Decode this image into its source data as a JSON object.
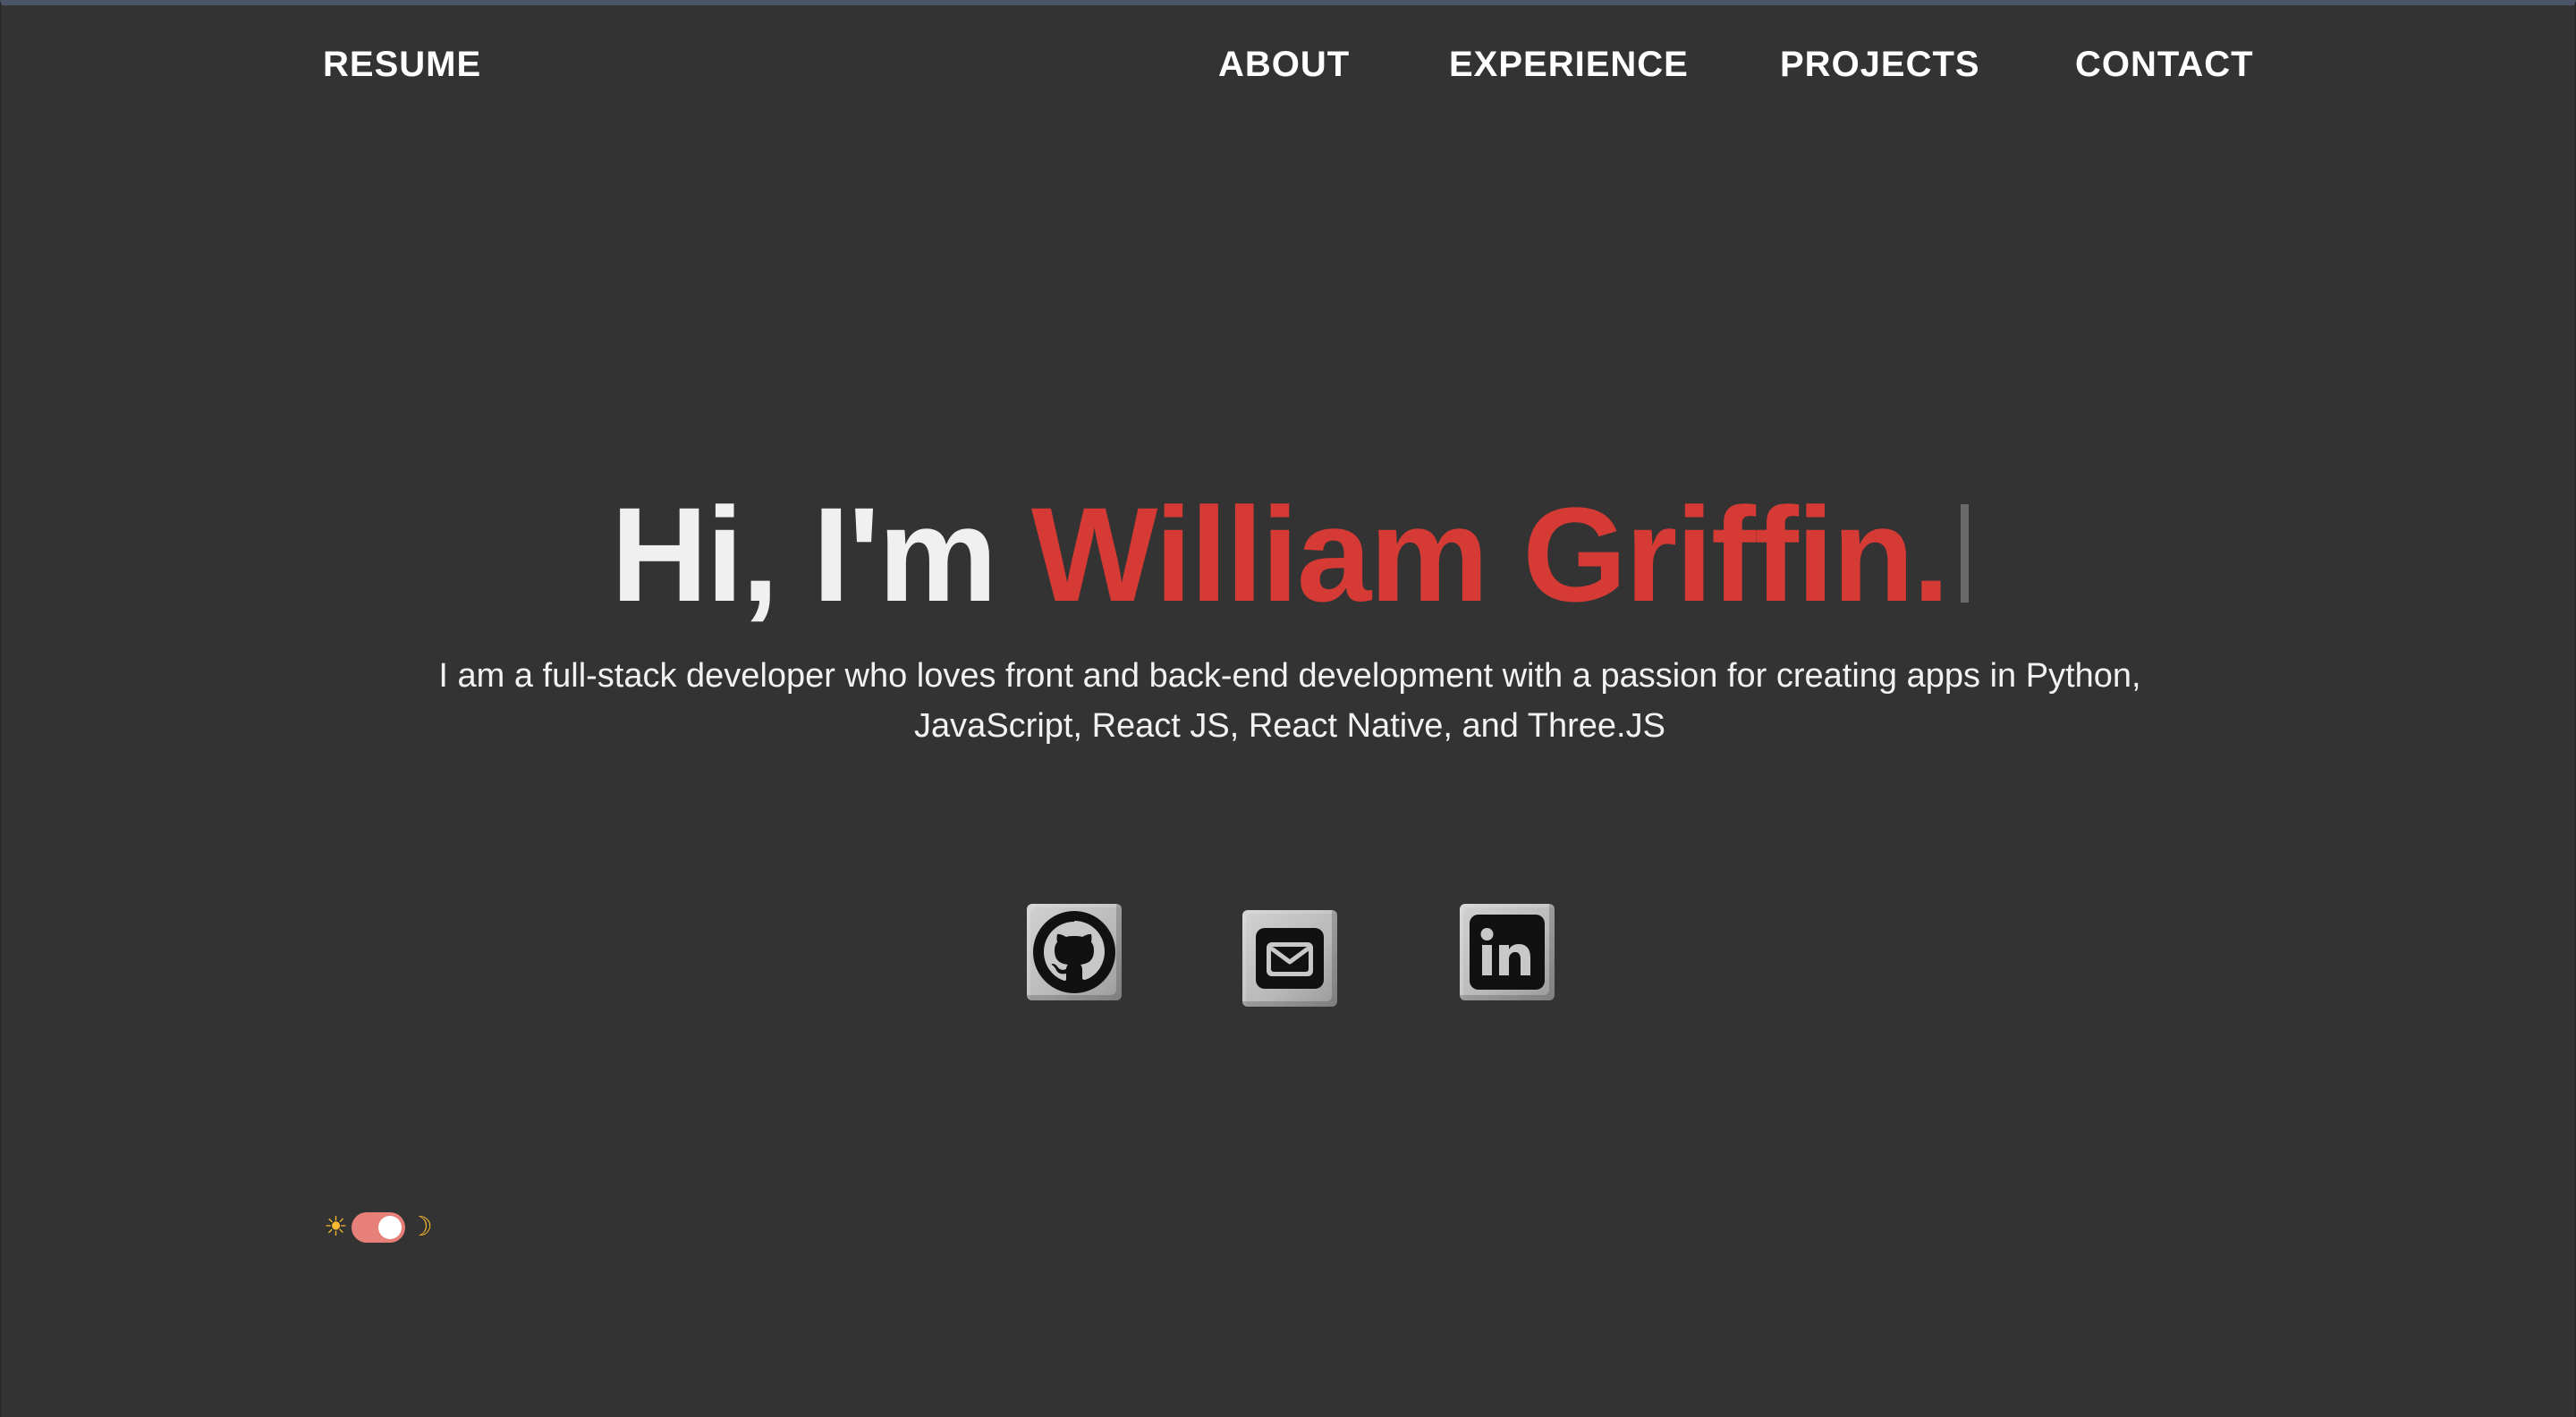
{
  "nav": {
    "resume": "RESUME",
    "about": "ABOUT",
    "experience": "EXPERIENCE",
    "projects": "PROJECTS",
    "contact": "CONTACT"
  },
  "hero": {
    "greeting": "Hi, I'm ",
    "name": "William Griffin.",
    "line1": "I am a full-stack developer who loves front and back-end development with a passion for creating apps in Python,",
    "line2": "JavaScript, React JS, React Native, and Three.JS"
  },
  "social": {
    "icons": [
      "github-icon",
      "email-icon",
      "linkedin-icon"
    ]
  },
  "theme": {
    "sun": "☀",
    "moon": "☽",
    "mode": "dark"
  },
  "colors": {
    "background": "#333333",
    "accent": "#d63a34",
    "toggle": "#e8807a"
  }
}
